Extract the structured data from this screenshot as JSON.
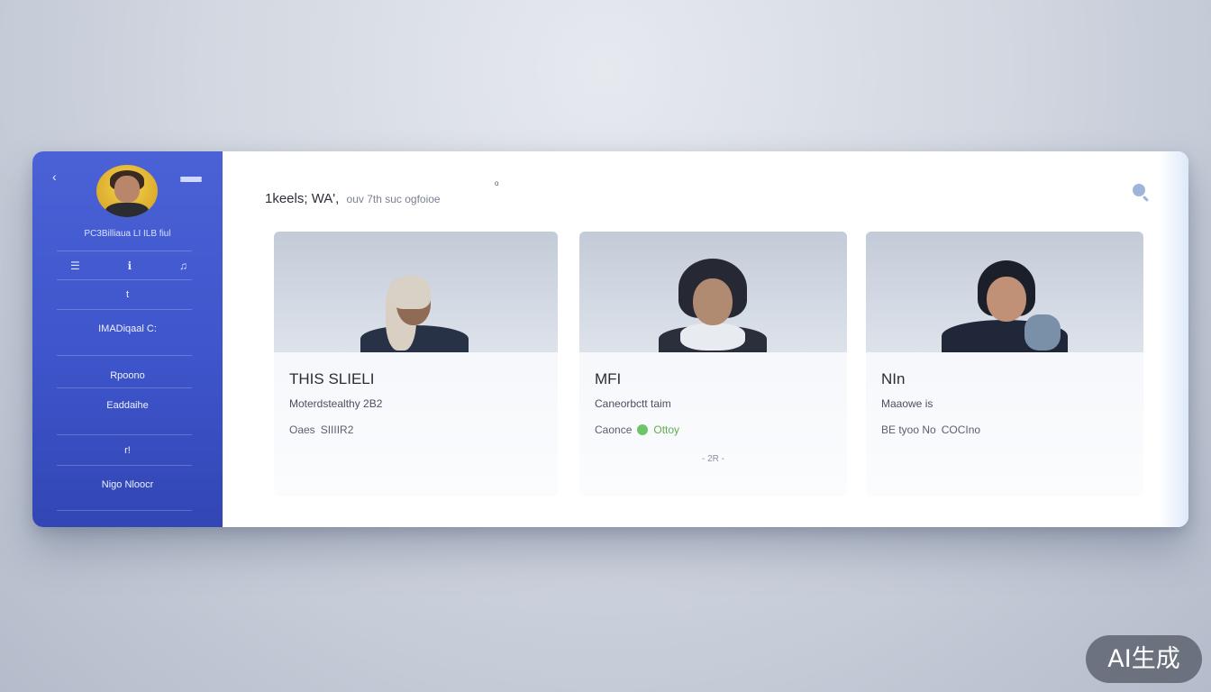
{
  "sidebar": {
    "profile_name": "PC3Billiaua LI ILB fiul",
    "icons": [
      "list-icon",
      "info-icon",
      "sound-icon"
    ],
    "items": [
      {
        "label": "t"
      },
      {
        "label": "IMADiqaal   C:"
      },
      {
        "label": "Rpoono"
      },
      {
        "label": "Eaddaihe"
      },
      {
        "label": "r!"
      },
      {
        "label": "Nigo Nloocr"
      }
    ],
    "colors": {
      "accent": "#3f56cd"
    }
  },
  "header": {
    "title": "1keels;  WA',",
    "subtitle": "ouv 7th suc ogfoioe",
    "dot": "o"
  },
  "cards": [
    {
      "title": "THIS  SLIELI",
      "line1": "Moterdstealthy 2B2",
      "line2_label": "Oaes",
      "line2_value": "SIIIIR2",
      "status": "",
      "note": ""
    },
    {
      "title": "MFI",
      "line1": "Caneorbctt  taim",
      "line2_label": "Caonce",
      "line2_value": "",
      "status": "Ottoy",
      "note": "- 2R -"
    },
    {
      "title": "NIn",
      "line1": "Maaowe  is",
      "line2_label": "BE tyoo  No",
      "line2_value": "COCIno",
      "status": "",
      "note": ""
    }
  ],
  "watermark": "AI生成"
}
